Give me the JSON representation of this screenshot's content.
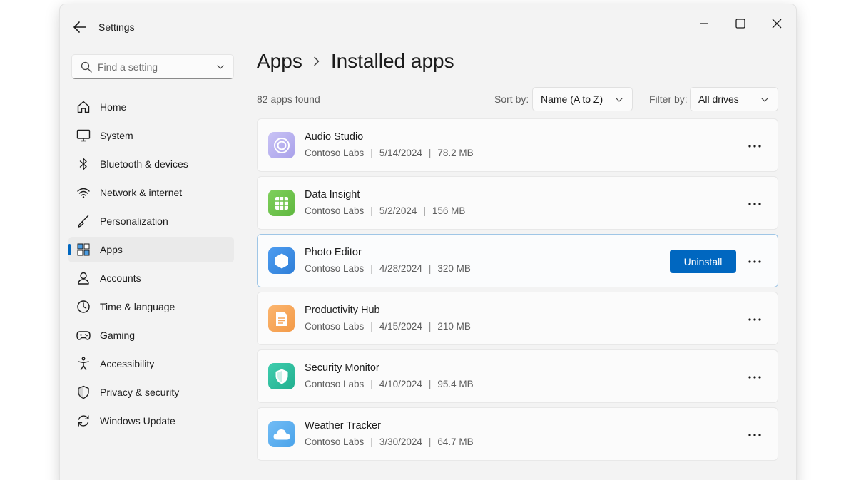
{
  "window": {
    "title": "Settings"
  },
  "search": {
    "placeholder": "Find a setting",
    "value": ""
  },
  "sidebar": {
    "items": [
      {
        "label": "Home",
        "icon": "home-icon",
        "active": false
      },
      {
        "label": "System",
        "icon": "monitor-icon",
        "active": false
      },
      {
        "label": "Bluetooth & devices",
        "icon": "bluetooth-icon",
        "active": false
      },
      {
        "label": "Network & internet",
        "icon": "wifi-icon",
        "active": false
      },
      {
        "label": "Personalization",
        "icon": "brush-icon",
        "active": false
      },
      {
        "label": "Apps",
        "icon": "apps-icon",
        "active": true
      },
      {
        "label": "Accounts",
        "icon": "person-icon",
        "active": false
      },
      {
        "label": "Time & language",
        "icon": "clock-icon",
        "active": false
      },
      {
        "label": "Gaming",
        "icon": "gamepad-icon",
        "active": false
      },
      {
        "label": "Accessibility",
        "icon": "accessibility-icon",
        "active": false
      },
      {
        "label": "Privacy & security",
        "icon": "shield-icon",
        "active": false
      },
      {
        "label": "Windows Update",
        "icon": "update-icon",
        "active": false
      }
    ]
  },
  "breadcrumb": {
    "parent": "Apps",
    "current": "Installed apps"
  },
  "toolbar": {
    "count_text": "82 apps found",
    "sort_label": "Sort by:",
    "sort_value": "Name (A to Z)",
    "filter_label": "Filter by:",
    "filter_value": "All drives"
  },
  "apps": [
    {
      "name": "Audio Studio",
      "publisher": "Contoso Labs",
      "date": "5/14/2024",
      "size": "78.2 MB",
      "icon": "audio-icon",
      "icon_color": "#b9b3ef",
      "selected": false
    },
    {
      "name": "Data Insight",
      "publisher": "Contoso Labs",
      "date": "5/2/2024",
      "size": "156 MB",
      "icon": "spreadsheet-icon",
      "icon_color": "#6cc24a",
      "selected": false
    },
    {
      "name": "Photo Editor",
      "publisher": "Contoso Labs",
      "date": "4/28/2024",
      "size": "320 MB",
      "icon": "hexagon-icon",
      "icon_color": "#3d8ee6",
      "selected": true,
      "action_label": "Uninstall"
    },
    {
      "name": "Productivity Hub",
      "publisher": "Contoso Labs",
      "date": "4/15/2024",
      "size": "210 MB",
      "icon": "document-icon",
      "icon_color": "#f7a65a",
      "selected": false
    },
    {
      "name": "Security Monitor",
      "publisher": "Contoso Labs",
      "date": "4/10/2024",
      "size": "95.4 MB",
      "icon": "shield-check-icon",
      "icon_color": "#2fbf9f",
      "selected": false
    },
    {
      "name": "Weather Tracker",
      "publisher": "Contoso Labs",
      "date": "3/30/2024",
      "size": "64.7 MB",
      "icon": "cloud-icon",
      "icon_color": "#5aaef0",
      "selected": false
    }
  ],
  "colors": {
    "accent": "#0067c0",
    "window_bg": "#f3f3f3",
    "card_bg": "#fbfbfb"
  }
}
